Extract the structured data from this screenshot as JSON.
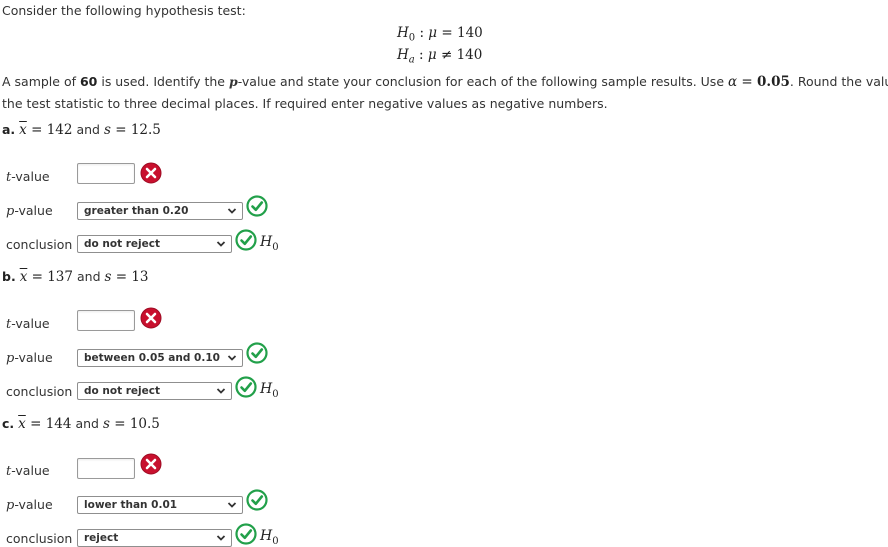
{
  "intro": "Consider the following hypothesis test:",
  "hypotheses": {
    "h0": {
      "symbol": "H",
      "sub": "0",
      "rhs": "140"
    },
    "ha": {
      "symbol": "H",
      "sub": "a",
      "rhs": "140"
    }
  },
  "instructions": {
    "line1_a": "A sample of ",
    "n": "60",
    "line1_b": " is used. Identify the ",
    "p": "p",
    "line1_c": "-value and state your conclusion for each of the following sample results. Use ",
    "alpha_val": "0.05",
    "line1_d": ". Round the value of",
    "line2": "the test statistic to three decimal places. If required enter negative values as negative numbers."
  },
  "labels": {
    "t_value_t": "t",
    "t_value_rest": "-value",
    "p_value_p": "p",
    "p_value_rest": "-value",
    "conclusion": "conclusion",
    "h0_symbol": "H",
    "h0_sub": "0",
    "and": "and"
  },
  "parts": [
    {
      "letter": "a.",
      "xbar": "142",
      "s": "12.5",
      "t_value": "",
      "t_status": "incorrect",
      "p_value": "greater than 0.20",
      "p_status": "correct",
      "conclusion": "do not reject",
      "c_status": "correct"
    },
    {
      "letter": "b.",
      "xbar": "137",
      "s": "13",
      "t_value": "",
      "t_status": "incorrect",
      "p_value": "between 0.05 and 0.10",
      "p_status": "correct",
      "conclusion": "do not reject",
      "c_status": "correct"
    },
    {
      "letter": "c.",
      "xbar": "144",
      "s": "10.5",
      "t_value": "",
      "t_status": "incorrect",
      "p_value": "lower than 0.01",
      "p_status": "correct",
      "conclusion": "reject",
      "c_status": "correct"
    }
  ],
  "colors": {
    "correct": "#22a04a",
    "incorrect": "#c8102e"
  },
  "icons": {
    "correct": "check-circle-icon",
    "incorrect": "x-circle-icon",
    "dropdown": "chevron-down-icon"
  }
}
